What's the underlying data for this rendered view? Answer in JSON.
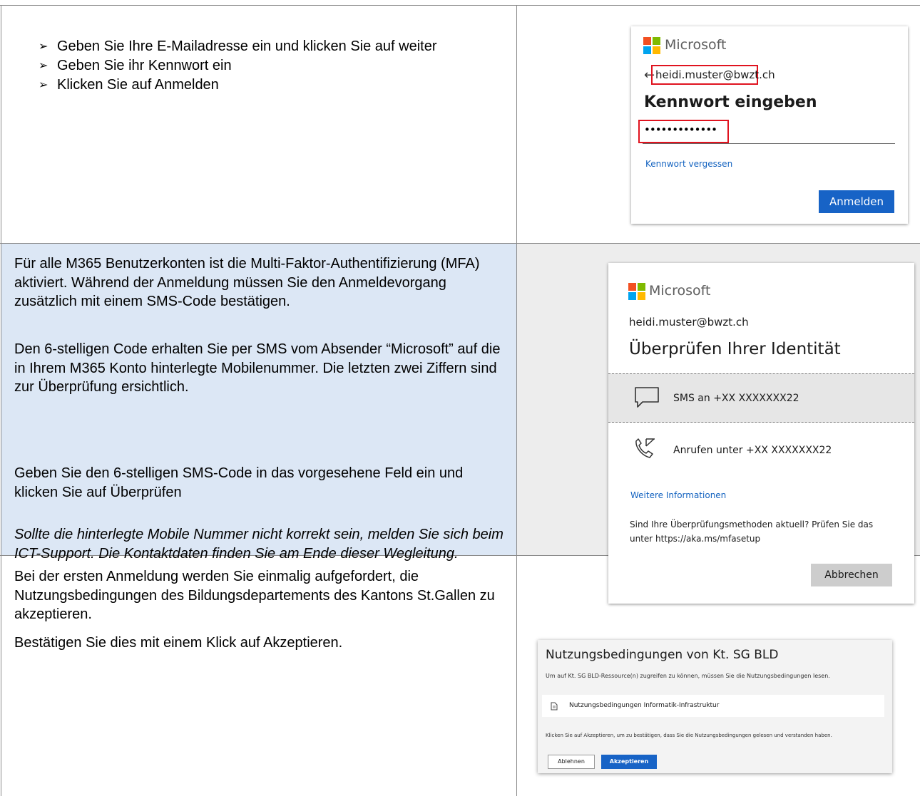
{
  "row1": {
    "steps": [
      "Geben Sie Ihre E-Mailadresse ein und klicken Sie auf weiter",
      "Geben Sie ihr Kennwort ein",
      "Klicken Sie auf Anmelden"
    ],
    "card": {
      "brand": "Microsoft",
      "email": "heidi.muster@bwzt.ch",
      "title": "Kennwort eingeben",
      "password_value": "•••••••••••••",
      "forgot_link": "Kennwort vergessen",
      "signin_button": "Anmelden"
    }
  },
  "row2": {
    "para1": "Für alle M365 Benutzerkonten ist die Multi-Faktor-Authentifizierung (MFA) aktiviert. Während der Anmeldung müssen Sie den Anmeldevorgang zusätzlich mit einem SMS-Code bestätigen.",
    "para2": "Den 6-stelligen Code erhalten Sie per SMS vom Absender “Microsoft” auf die in Ihrem M365 Konto hinterlegte Mobilenummer. Die letzten zwei Ziffern sind zur Überprüfung ersichtlich.",
    "para3": "Geben Sie den 6-stelligen SMS-Code in das vorgesehene Feld ein und klicken Sie auf Überprüfen",
    "para4": "Sollte die hinterlegte Mobile Nummer nicht korrekt sein, melden Sie sich beim ICT-Support. Die Kontaktdaten finden Sie am Ende dieser Wegleitung.",
    "card": {
      "brand": "Microsoft",
      "email": "heidi.muster@bwzt.ch",
      "title": "Überprüfen Ihrer Identität",
      "option_sms": "SMS an +XX XXXXXXX22",
      "option_call": "Anrufen unter +XX XXXXXXX22",
      "more_info_link": "Weitere Informationen",
      "check_text": "Sind Ihre Überprüfungsmethoden aktuell? Prüfen Sie das unter https://aka.ms/mfasetup",
      "cancel_button": "Abbrechen"
    }
  },
  "row3": {
    "para1": "Bei der ersten Anmeldung werden Sie einmalig aufgefordert, die Nutzungsbedingungen des Bildungsdepartements des Kantons St.Gallen zu akzeptieren.",
    "para2": "Bestätigen Sie dies mit einem Klick auf Akzeptieren.",
    "card": {
      "title": "Nutzungsbedingungen von Kt. SG BLD",
      "intro": "Um auf Kt. SG BLD-Ressource(n) zugreifen zu können, müssen Sie die Nutzungsbedingungen lesen.",
      "document_link": "Nutzungsbedingungen Informatik-Infrastruktur",
      "confirm_text": "Klicken Sie auf Akzeptieren, um zu bestätigen, dass Sie die Nutzungsbedingungen gelesen und verstanden haben.",
      "decline_button": "Ablehnen",
      "accept_button": "Akzeptieren"
    }
  },
  "colors": {
    "highlight_bg": "#dce7f5",
    "grey_bg": "#ededed",
    "ms_red": "#f25022",
    "ms_green": "#7fba00",
    "ms_blue": "#00a4ef",
    "ms_yellow": "#ffb900",
    "accent_blue": "#1763c6",
    "red_highlight": "#e0131f"
  }
}
